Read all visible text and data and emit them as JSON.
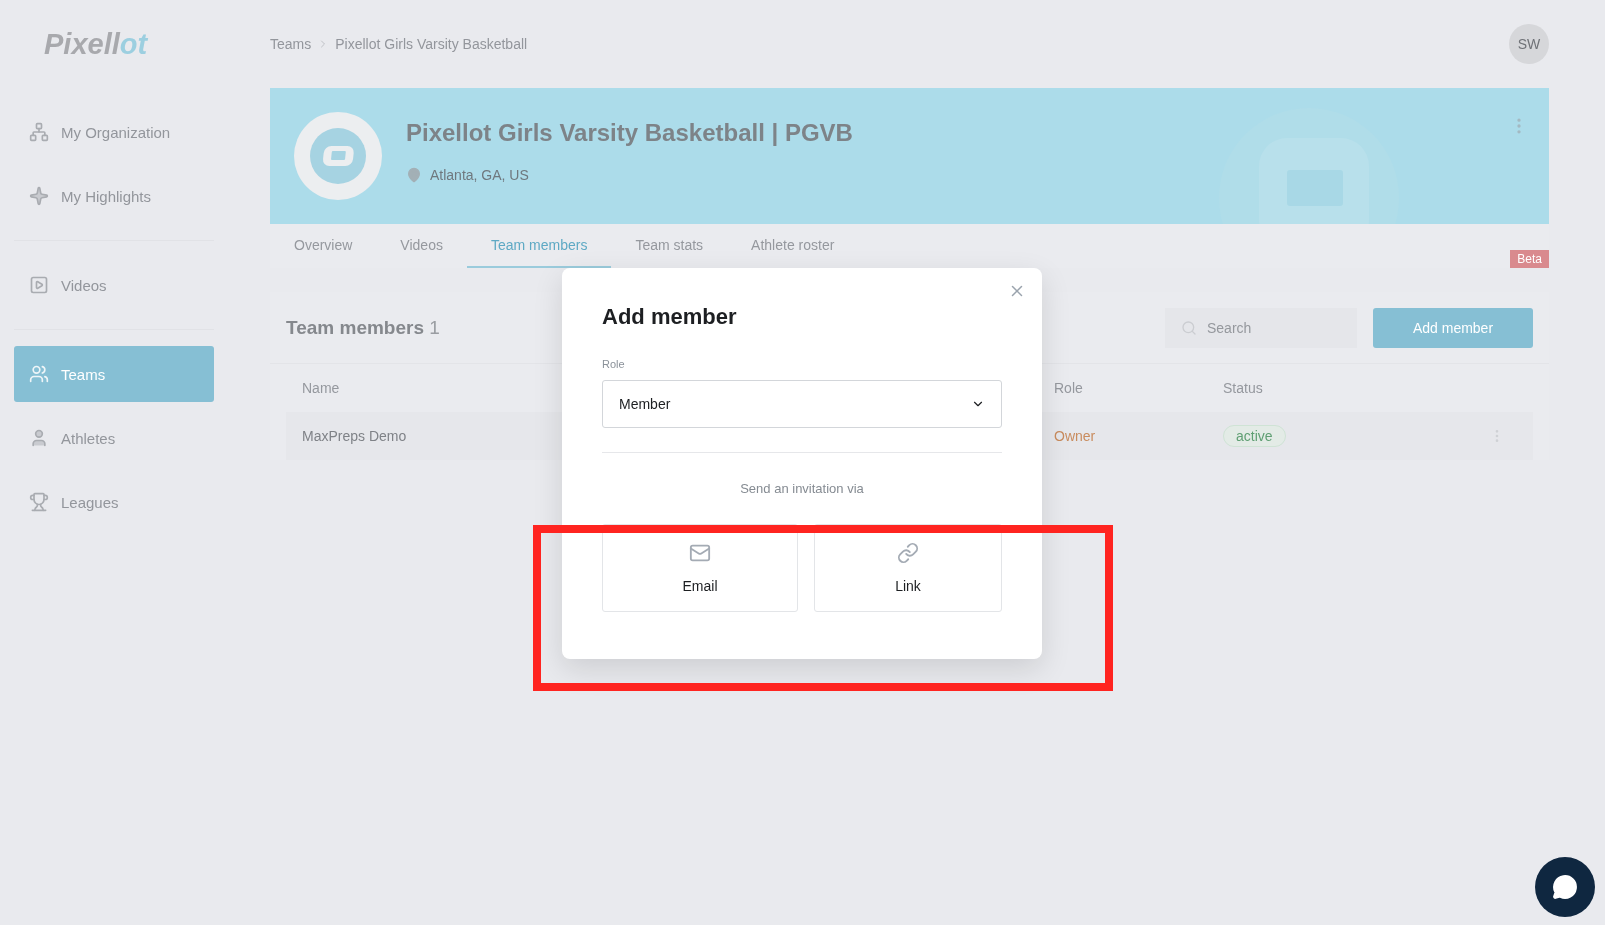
{
  "logo": {
    "text": "Pixell",
    "accent": "ot"
  },
  "sidebar": {
    "groups": [
      [
        {
          "kind": "organization",
          "label": "My Organization",
          "selected": false
        },
        {
          "kind": "highlights",
          "label": "My Highlights",
          "selected": false
        }
      ],
      [
        {
          "kind": "videos",
          "label": "Videos",
          "selected": false
        }
      ],
      [
        {
          "kind": "teams",
          "label": "Teams",
          "selected": true
        },
        {
          "kind": "athletes",
          "label": "Athletes",
          "selected": false
        },
        {
          "kind": "leagues",
          "label": "Leagues",
          "selected": false
        }
      ]
    ]
  },
  "breadcrumb": [
    "Teams",
    "Pixellot Girls Varsity Basketball"
  ],
  "avatar": "SW",
  "team": {
    "name": "Pixellot Girls Varsity Basketball | PGVB",
    "location": "Atlanta, GA, US"
  },
  "tabs": [
    {
      "label": "Overview",
      "selected": false
    },
    {
      "label": "Videos",
      "selected": false
    },
    {
      "label": "Team members",
      "selected": true
    },
    {
      "label": "Team stats",
      "selected": false
    },
    {
      "label": "Athlete roster",
      "selected": false
    }
  ],
  "beta": "Beta",
  "members": {
    "title": "Team members",
    "count": "1",
    "search_placeholder": "Search",
    "add_button": "Add member",
    "columns": [
      "Name",
      "Role",
      "Status"
    ],
    "rows": [
      {
        "name": "MaxPreps Demo",
        "role": "Owner",
        "status": "active"
      }
    ]
  },
  "modal": {
    "title": "Add member",
    "role_label": "Role",
    "role_value": "Member",
    "invite_label": "Send an invitation via",
    "options": [
      {
        "kind": "email",
        "label": "Email"
      },
      {
        "kind": "link",
        "label": "Link"
      }
    ]
  }
}
